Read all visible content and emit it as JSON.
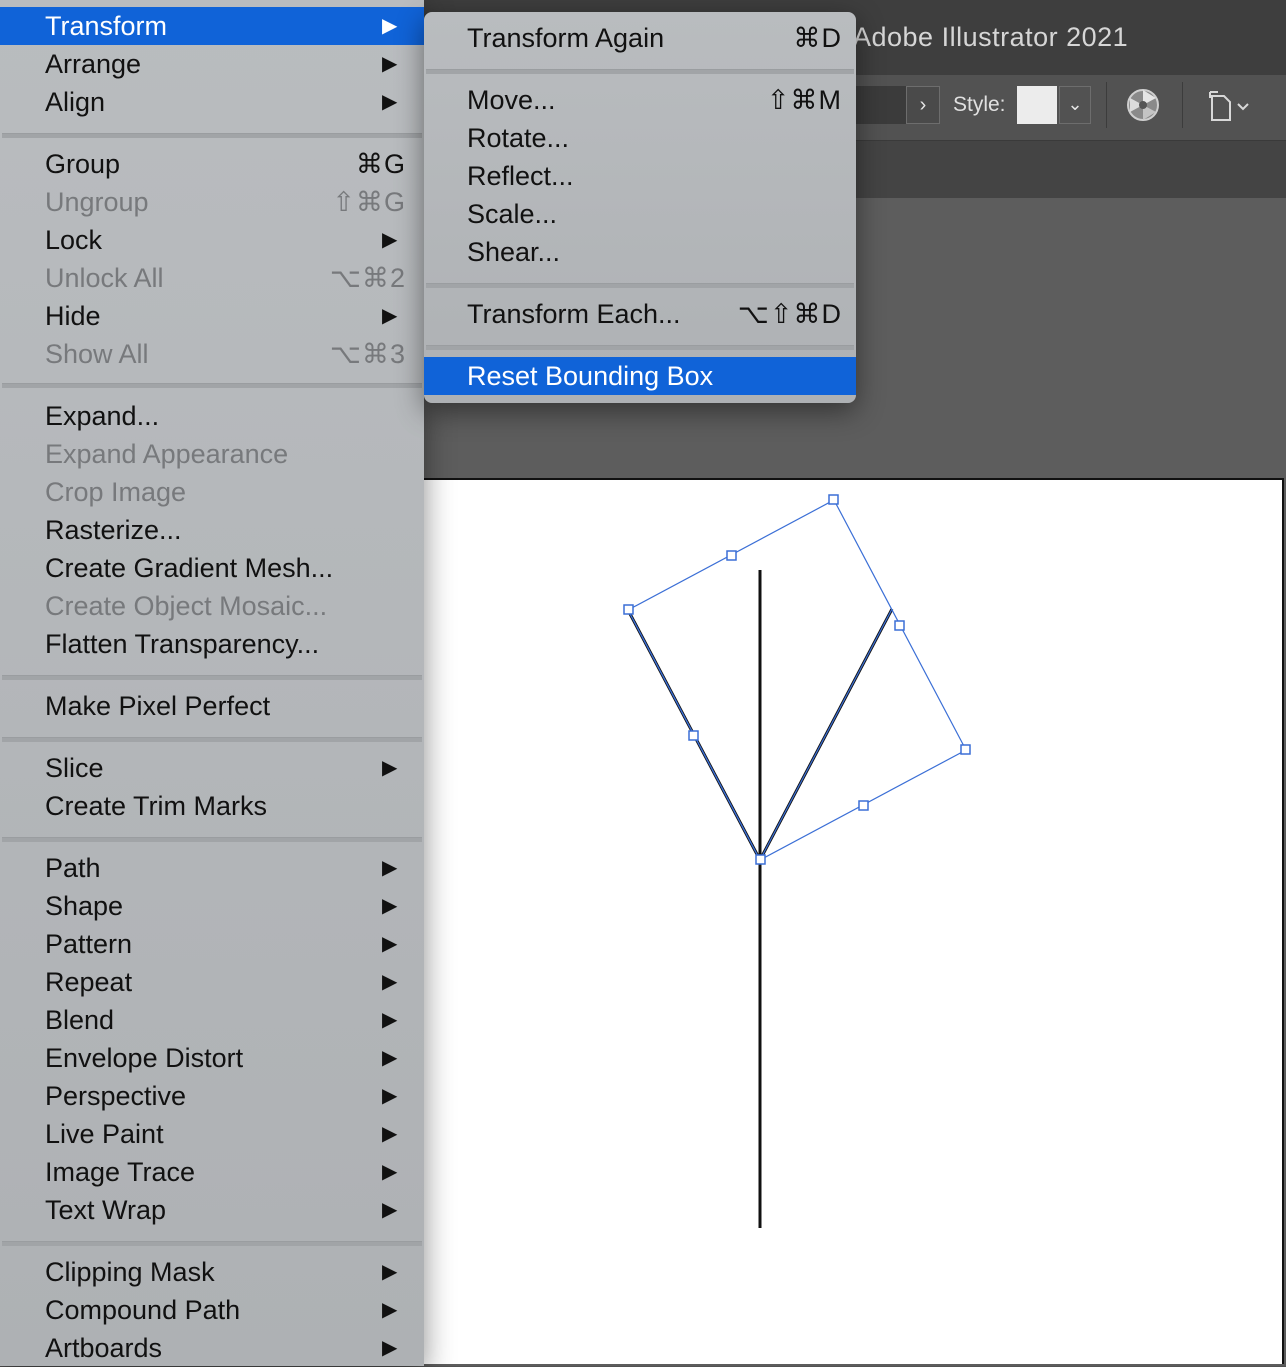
{
  "app": {
    "title": "Adobe Illustrator 2021"
  },
  "controlbar": {
    "style_label": "Style:",
    "next_glyph": "›",
    "dropdown_glyph": "⌄"
  },
  "object_menu": {
    "items": [
      {
        "label": "Transform",
        "shortcut": "",
        "submenu": true,
        "enabled": true,
        "highlighted": true
      },
      {
        "label": "Arrange",
        "shortcut": "",
        "submenu": true,
        "enabled": true
      },
      {
        "label": "Align",
        "shortcut": "",
        "submenu": true,
        "enabled": true
      },
      {
        "label": "Group",
        "shortcut": "⌘G",
        "submenu": false,
        "enabled": true
      },
      {
        "label": "Ungroup",
        "shortcut": "⇧⌘G",
        "submenu": false,
        "enabled": false
      },
      {
        "label": "Lock",
        "shortcut": "",
        "submenu": true,
        "enabled": true
      },
      {
        "label": "Unlock All",
        "shortcut": "⌥⌘2",
        "submenu": false,
        "enabled": false
      },
      {
        "label": "Hide",
        "shortcut": "",
        "submenu": true,
        "enabled": true
      },
      {
        "label": "Show All",
        "shortcut": "⌥⌘3",
        "submenu": false,
        "enabled": false
      },
      {
        "label": "Expand...",
        "shortcut": "",
        "submenu": false,
        "enabled": true
      },
      {
        "label": "Expand Appearance",
        "shortcut": "",
        "submenu": false,
        "enabled": false
      },
      {
        "label": "Crop Image",
        "shortcut": "",
        "submenu": false,
        "enabled": false
      },
      {
        "label": "Rasterize...",
        "shortcut": "",
        "submenu": false,
        "enabled": true
      },
      {
        "label": "Create Gradient Mesh...",
        "shortcut": "",
        "submenu": false,
        "enabled": true
      },
      {
        "label": "Create Object Mosaic...",
        "shortcut": "",
        "submenu": false,
        "enabled": false
      },
      {
        "label": "Flatten Transparency...",
        "shortcut": "",
        "submenu": false,
        "enabled": true
      },
      {
        "label": "Make Pixel Perfect",
        "shortcut": "",
        "submenu": false,
        "enabled": true
      },
      {
        "label": "Slice",
        "shortcut": "",
        "submenu": true,
        "enabled": true
      },
      {
        "label": "Create Trim Marks",
        "shortcut": "",
        "submenu": false,
        "enabled": true
      },
      {
        "label": "Path",
        "shortcut": "",
        "submenu": true,
        "enabled": true
      },
      {
        "label": "Shape",
        "shortcut": "",
        "submenu": true,
        "enabled": true
      },
      {
        "label": "Pattern",
        "shortcut": "",
        "submenu": true,
        "enabled": true
      },
      {
        "label": "Repeat",
        "shortcut": "",
        "submenu": true,
        "enabled": true
      },
      {
        "label": "Blend",
        "shortcut": "",
        "submenu": true,
        "enabled": true
      },
      {
        "label": "Envelope Distort",
        "shortcut": "",
        "submenu": true,
        "enabled": true
      },
      {
        "label": "Perspective",
        "shortcut": "",
        "submenu": true,
        "enabled": true
      },
      {
        "label": "Live Paint",
        "shortcut": "",
        "submenu": true,
        "enabled": true
      },
      {
        "label": "Image Trace",
        "shortcut": "",
        "submenu": true,
        "enabled": true
      },
      {
        "label": "Text Wrap",
        "shortcut": "",
        "submenu": true,
        "enabled": true
      },
      {
        "label": "Clipping Mask",
        "shortcut": "",
        "submenu": true,
        "enabled": true
      },
      {
        "label": "Compound Path",
        "shortcut": "",
        "submenu": true,
        "enabled": true
      },
      {
        "label": "Artboards",
        "shortcut": "",
        "submenu": true,
        "enabled": true
      }
    ],
    "submenu_arrow": "▶"
  },
  "transform_submenu": {
    "items": [
      {
        "label": "Transform Again",
        "shortcut": "⌘D",
        "enabled": true
      },
      {
        "label": "Move...",
        "shortcut": "⇧⌘M",
        "enabled": true
      },
      {
        "label": "Rotate...",
        "shortcut": "",
        "enabled": true
      },
      {
        "label": "Reflect...",
        "shortcut": "",
        "enabled": true
      },
      {
        "label": "Scale...",
        "shortcut": "",
        "enabled": true
      },
      {
        "label": "Shear...",
        "shortcut": "",
        "enabled": true
      },
      {
        "label": "Transform Each...",
        "shortcut": "⌥⇧⌘D",
        "enabled": true
      },
      {
        "label": "Reset Bounding Box",
        "shortcut": "",
        "enabled": true,
        "highlighted": true
      }
    ]
  },
  "colors": {
    "highlight": "#1063d8",
    "selection": "#3b6fd6",
    "menu_bg": "#b4b7ba",
    "disabled_text": "#77797c"
  }
}
